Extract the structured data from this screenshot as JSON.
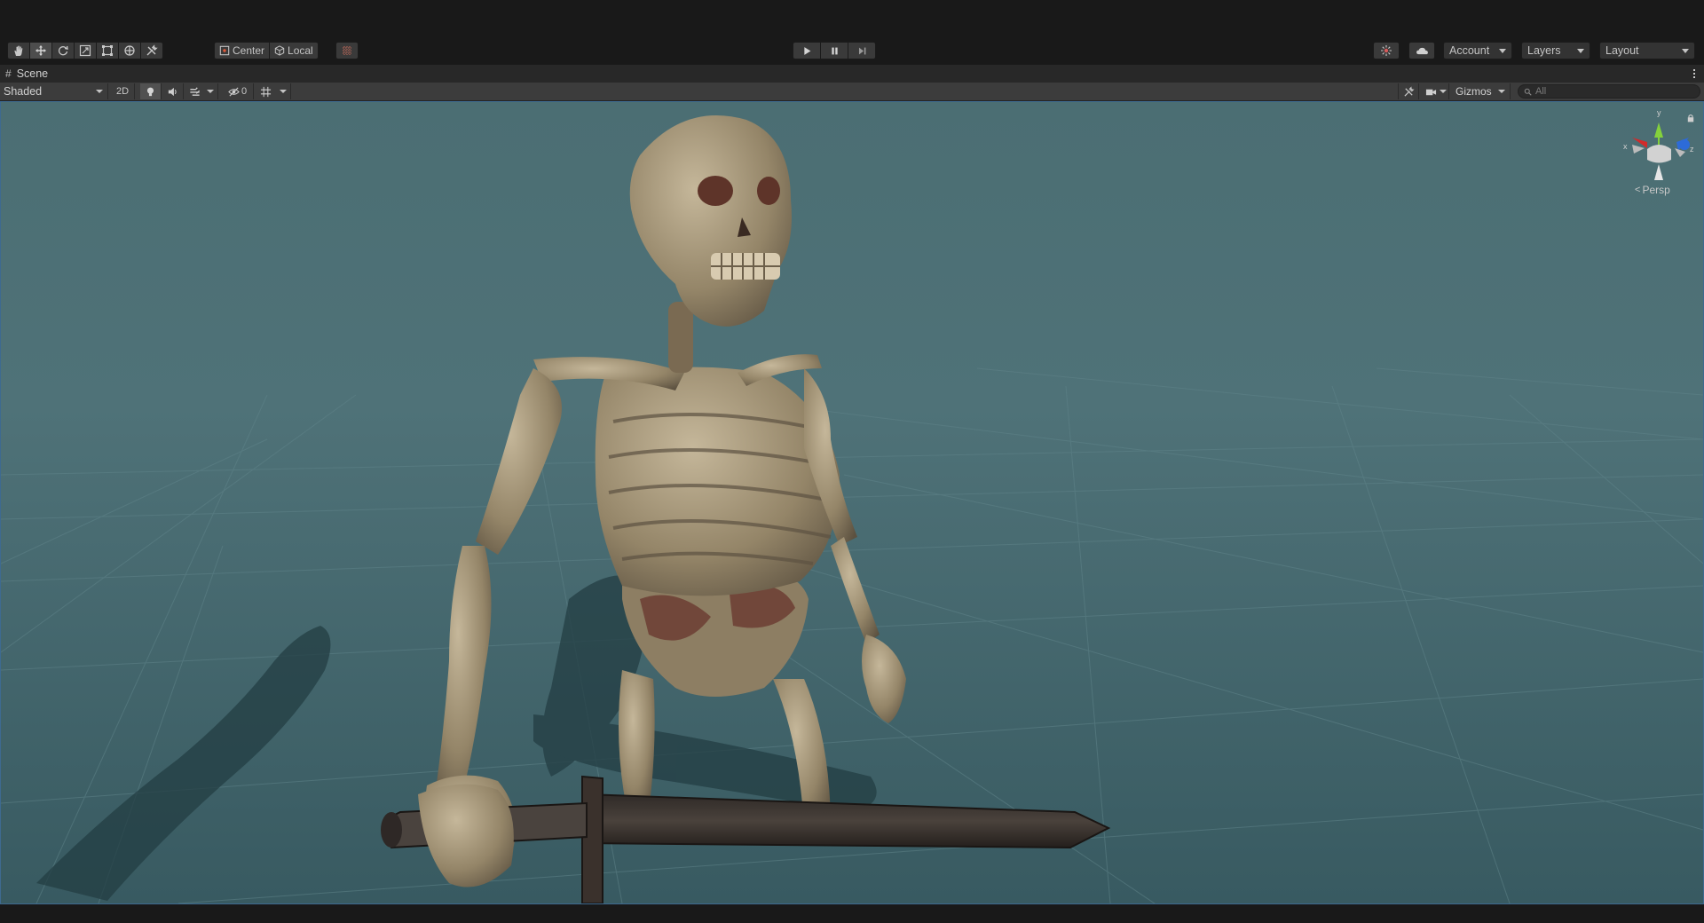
{
  "toolbar": {
    "tools": [
      {
        "name": "hand-tool",
        "icon": "hand-icon"
      },
      {
        "name": "move-tool",
        "icon": "move-icon",
        "active": true
      },
      {
        "name": "rotate-tool",
        "icon": "rotate-icon"
      },
      {
        "name": "scale-tool",
        "icon": "scale-icon"
      },
      {
        "name": "rect-tool",
        "icon": "rect-icon"
      },
      {
        "name": "transform-tool",
        "icon": "transform-icon"
      },
      {
        "name": "custom-tool",
        "icon": "tools-icon"
      }
    ],
    "pivot_mode": "Center",
    "pivot_rotation": "Local",
    "snap_icon": "grid-snap-icon",
    "play_icon": "play-icon",
    "pause_icon": "pause-icon",
    "step_icon": "step-icon",
    "collab_icon": "collab-icon",
    "cloud_icon": "cloud-icon",
    "account": "Account",
    "layers": "Layers",
    "layout": "Layout"
  },
  "tab": {
    "title": "Scene",
    "icon": "scene-hash-icon",
    "menu_icon": "kebab-menu-icon"
  },
  "scene_toolbar": {
    "draw_mode": "Shaded",
    "mode_2d": "2D",
    "lighting_icon": "bulb-icon",
    "audio_icon": "speaker-icon",
    "effects_icon": "effects-icon",
    "hidden_count": "0",
    "grid_icon": "grid-icon",
    "tools_icon": "tools-icon",
    "camera_icon": "camera-icon",
    "gizmos": "Gizmos",
    "search_placeholder": "All"
  },
  "viewport": {
    "projection": "Persp",
    "axis_labels": {
      "x": "x",
      "y": "y",
      "z": "z"
    },
    "colors": {
      "x_axis": "#d12b2b",
      "y_axis": "#84d13c",
      "z_axis": "#2d6bd8",
      "sky": "#4d6f75",
      "ground": "#3c5c63",
      "selection_border": "#3e6a90"
    }
  }
}
